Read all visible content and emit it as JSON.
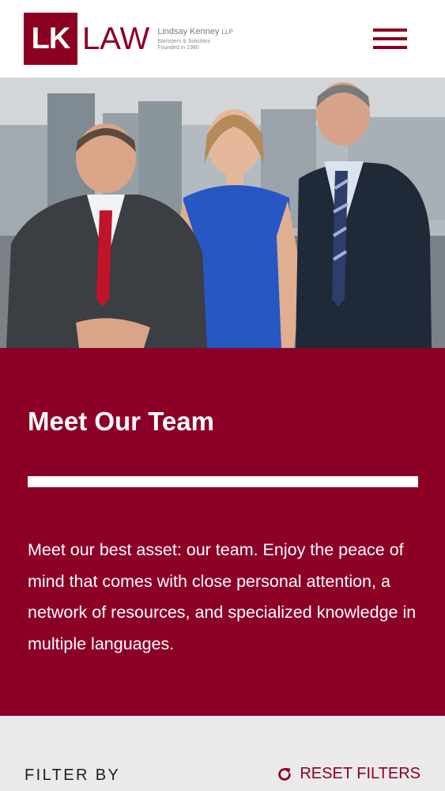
{
  "header": {
    "logo": {
      "mark": "LK",
      "word": "LAW",
      "firm_name": "Lindsay Kenney",
      "firm_suffix": "LLP",
      "line1": "Barristers & Solicitors",
      "line2": "Founded in 1980"
    },
    "menu_icon": "hamburger-menu-icon"
  },
  "colors": {
    "brand": "#8c0022",
    "panel": "#8c0028",
    "filter_bg": "#eaeaea"
  },
  "intro": {
    "title": "Meet Our Team",
    "body": "Meet our best asset: our team. Enjoy the peace of mind that comes with close personal attention, a network of resources, and specialized knowledge in multiple languages."
  },
  "filter": {
    "label": "FILTER BY",
    "reset_label": "RESET FILTERS",
    "reset_icon": "refresh-icon"
  }
}
